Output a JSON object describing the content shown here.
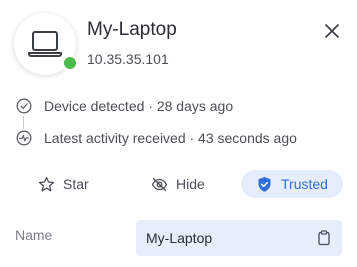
{
  "device": {
    "name": "My-Laptop",
    "ip": "10.35.35.101",
    "status_color": "#4bbb4b"
  },
  "info": {
    "detected": "Device detected · 28 days ago",
    "activity": "Latest activity received · 43 seconds ago"
  },
  "actions": {
    "star_label": "Star",
    "hide_label": "Hide",
    "trusted_label": "Trusted"
  },
  "form": {
    "name_label": "Name",
    "name_value": "My-Laptop"
  },
  "icons": [
    "laptop-icon",
    "close-icon",
    "check-circle-icon",
    "activity-icon",
    "star-icon",
    "eye-off-icon",
    "shield-check-icon",
    "clipboard-icon"
  ],
  "colors": {
    "accent": "#2f6fd6",
    "accent_bg": "#e6eefb"
  }
}
